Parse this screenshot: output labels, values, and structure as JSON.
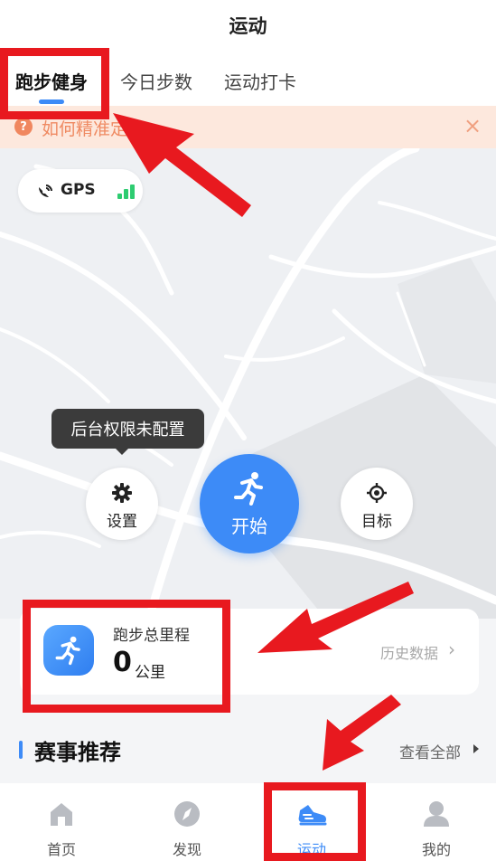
{
  "header": {
    "title": "运动"
  },
  "tabs": [
    {
      "label": "跑步健身",
      "active": true
    },
    {
      "label": "今日步数",
      "active": false
    },
    {
      "label": "运动打卡",
      "active": false
    }
  ],
  "notice": {
    "icon": "question-icon",
    "icon_glyph": "?",
    "text": "如何精准定位",
    "close_glyph": "×"
  },
  "gps": {
    "label": "GPS",
    "signal_bars": 3,
    "signal_color": "#2ecc71"
  },
  "tooltip": {
    "text": "后台权限未配置"
  },
  "controls": {
    "settings_label": "设置",
    "start_label": "开始",
    "target_label": "目标"
  },
  "mileage": {
    "title": "跑步总里程",
    "value": "0",
    "unit": "公里",
    "history_label": "历史数据",
    "chevron": "›"
  },
  "events": {
    "title": "赛事推荐",
    "see_all": "查看全部"
  },
  "bottom_nav": [
    {
      "label": "首页",
      "icon": "home-icon",
      "active": false
    },
    {
      "label": "发现",
      "icon": "compass-icon",
      "active": false
    },
    {
      "label": "运动",
      "icon": "sneaker-icon",
      "active": true
    },
    {
      "label": "我的",
      "icon": "profile-icon",
      "active": false
    }
  ],
  "colors": {
    "accent": "#3d8bf7",
    "annotation": "#e8191f",
    "notice_bg": "#fde8dd",
    "notice_text": "#ef8a62"
  }
}
